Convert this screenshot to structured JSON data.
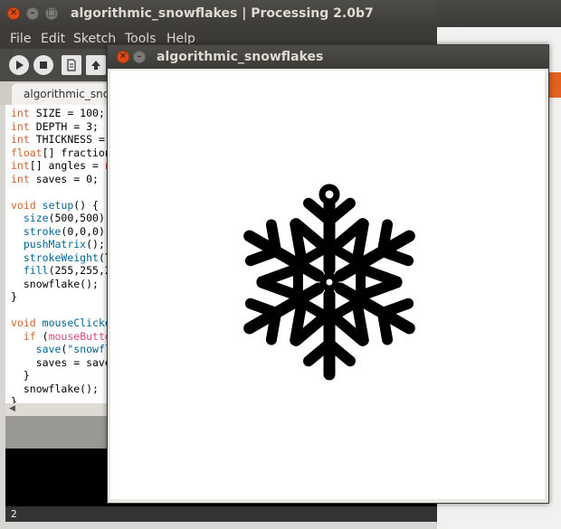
{
  "ide": {
    "title": "algorithmic_snowflakes | Processing 2.0b7",
    "menu": [
      "File",
      "Edit",
      "Sketch",
      "Tools",
      "Help"
    ],
    "tab_label": "algorithmic_sno",
    "code_lines": [
      [
        {
          "t": "int",
          "c": "kw"
        },
        {
          "t": " SIZE = 100;"
        }
      ],
      [
        {
          "t": "int",
          "c": "kw"
        },
        {
          "t": " DEPTH = 3;"
        }
      ],
      [
        {
          "t": "int",
          "c": "kw"
        },
        {
          "t": " THICKNESS ="
        }
      ],
      [
        {
          "t": "float",
          "c": "kw"
        },
        {
          "t": "[] fraction"
        }
      ],
      [
        {
          "t": "int",
          "c": "kw"
        },
        {
          "t": "[] angles = "
        },
        {
          "t": "ne",
          "c": "kw"
        }
      ],
      [
        {
          "t": "int",
          "c": "kw"
        },
        {
          "t": " saves = 0;"
        }
      ],
      [
        {
          "t": ""
        }
      ],
      [
        {
          "t": "void",
          "c": "kw"
        },
        {
          "t": " "
        },
        {
          "t": "setup",
          "c": "fn"
        },
        {
          "t": "() {"
        }
      ],
      [
        {
          "t": "  "
        },
        {
          "t": "size",
          "c": "fn"
        },
        {
          "t": "(500,500);"
        }
      ],
      [
        {
          "t": "  "
        },
        {
          "t": "stroke",
          "c": "fn"
        },
        {
          "t": "(0,0,0);"
        }
      ],
      [
        {
          "t": "  "
        },
        {
          "t": "pushMatrix",
          "c": "fn"
        },
        {
          "t": "();"
        }
      ],
      [
        {
          "t": "  "
        },
        {
          "t": "strokeWeight",
          "c": "fn"
        },
        {
          "t": "(T"
        }
      ],
      [
        {
          "t": "  "
        },
        {
          "t": "fill",
          "c": "fn"
        },
        {
          "t": "(255,255,2"
        }
      ],
      [
        {
          "t": "  snowflake();"
        }
      ],
      [
        {
          "t": "}"
        }
      ],
      [
        {
          "t": ""
        }
      ],
      [
        {
          "t": "void",
          "c": "kw"
        },
        {
          "t": " "
        },
        {
          "t": "mouseClicke",
          "c": "fn"
        }
      ],
      [
        {
          "t": "  "
        },
        {
          "t": "if",
          "c": "kw"
        },
        {
          "t": " ("
        },
        {
          "t": "mouseButto",
          "c": "pink"
        }
      ],
      [
        {
          "t": "    "
        },
        {
          "t": "save",
          "c": "fn"
        },
        {
          "t": "("
        },
        {
          "t": "\"snowfl",
          "c": "fn"
        }
      ],
      [
        {
          "t": "    saves = save"
        }
      ],
      [
        {
          "t": "  }"
        }
      ],
      [
        {
          "t": "  snowflake();"
        }
      ],
      [
        {
          "t": "}"
        }
      ]
    ],
    "status_line": "2"
  },
  "sketch": {
    "title": "algorithmic_snowflakes"
  },
  "icons": {
    "run": "play-icon",
    "stop": "stop-icon",
    "new": "new-file-icon",
    "open": "open-icon"
  }
}
